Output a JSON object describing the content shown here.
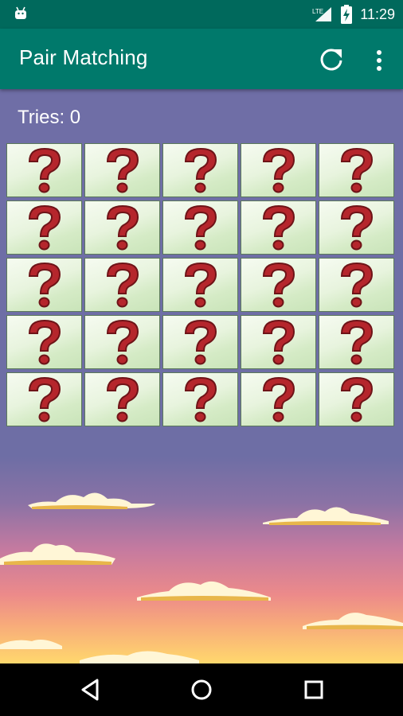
{
  "status_bar": {
    "time": "11:29",
    "network": "LTE",
    "icons": [
      "android-icon",
      "lte-signal-icon",
      "battery-charging-icon"
    ]
  },
  "app_bar": {
    "title": "Pair Matching",
    "actions": [
      "refresh-icon",
      "overflow-menu-icon"
    ]
  },
  "game": {
    "tries_label": "Tries: 0",
    "grid": {
      "rows": 5,
      "columns": 5
    },
    "card_face": "question-mark-icon",
    "colors": {
      "question_mark": "#b5262c",
      "sky_top": "#6f6ea6",
      "sky_bottom": "#ffd86d"
    }
  },
  "nav_bar": {
    "buttons": [
      "back-icon",
      "home-icon",
      "recents-icon"
    ]
  }
}
